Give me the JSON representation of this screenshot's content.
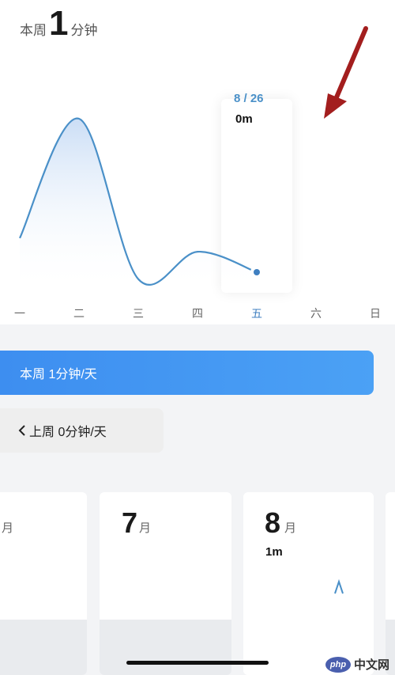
{
  "header": {
    "prefix": "本周",
    "value": "1",
    "unit": "分钟"
  },
  "chart_data": {
    "type": "line",
    "categories": [
      "一",
      "二",
      "三",
      "四",
      "五",
      "六",
      "日"
    ],
    "values": [
      1,
      4.5,
      -0.2,
      0.6,
      0
    ],
    "highlight_index": 4,
    "colors": {
      "line": "#4a90c8",
      "fill": "#d6e6f8"
    }
  },
  "tooltip": {
    "date": "8 / 26",
    "value": "0m"
  },
  "summary": {
    "this_week": "本周 1分钟/天",
    "last_week": "上周 0分钟/天",
    "last_week_icon": "chevron-left-icon"
  },
  "months": [
    {
      "label": "月",
      "number": "",
      "value": ""
    },
    {
      "label": "月",
      "number": "7",
      "value": ""
    },
    {
      "label": "月",
      "number": "8",
      "value": "1m"
    }
  ],
  "watermark": {
    "logo": "php",
    "text": "中文网"
  },
  "colors": {
    "accent": "#3d8ef0",
    "arrow": "#a31e1e"
  }
}
